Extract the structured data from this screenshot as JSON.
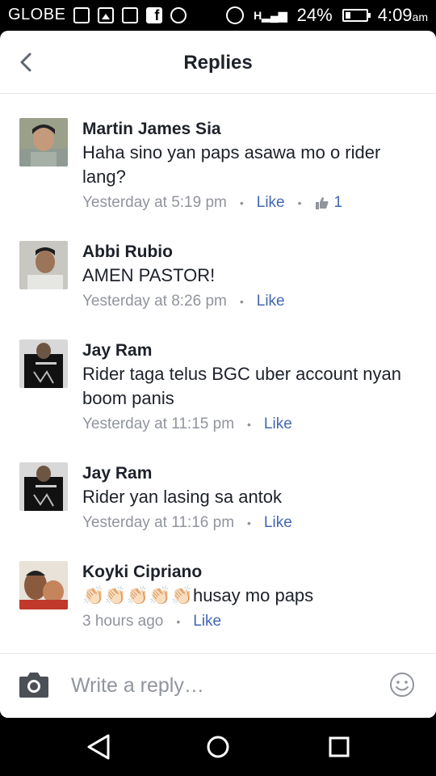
{
  "status_bar": {
    "carrier": "GLOBE",
    "battery": "24%",
    "time": "4:09",
    "ampm": "am",
    "icons": [
      "sim-icon",
      "photo-icon",
      "gmail-icon",
      "facebook-icon",
      "messenger-icon",
      "alarm-icon",
      "signal-icon",
      "battery-icon"
    ]
  },
  "header": {
    "title": "Replies"
  },
  "replies": [
    {
      "name": "Martin James Sia",
      "text": "Haha sino yan paps asawa mo o rider lang?",
      "time": "Yesterday at 5:19 pm",
      "like_label": "Like",
      "like_count": "1"
    },
    {
      "name": "Abbi Rubio",
      "text": "AMEN PASTOR!",
      "time": "Yesterday at 8:26 pm",
      "like_label": "Like"
    },
    {
      "name": "Jay Ram",
      "text": "Rider taga telus BGC uber account nyan boom panis",
      "time": "Yesterday at 11:15 pm",
      "like_label": "Like"
    },
    {
      "name": "Jay Ram",
      "text": "Rider yan lasing sa antok",
      "time": "Yesterday at 11:16 pm",
      "like_label": "Like"
    },
    {
      "name": "Koyki Cipriano",
      "text": "👏🏻👏🏻👏🏻👏🏻👏🏻husay mo paps",
      "time": "3 hours ago",
      "like_label": "Like"
    }
  ],
  "composer": {
    "placeholder": "Write a reply…"
  },
  "colors": {
    "link": "#4267b2",
    "meta": "#90949c",
    "text": "#1d2129"
  }
}
